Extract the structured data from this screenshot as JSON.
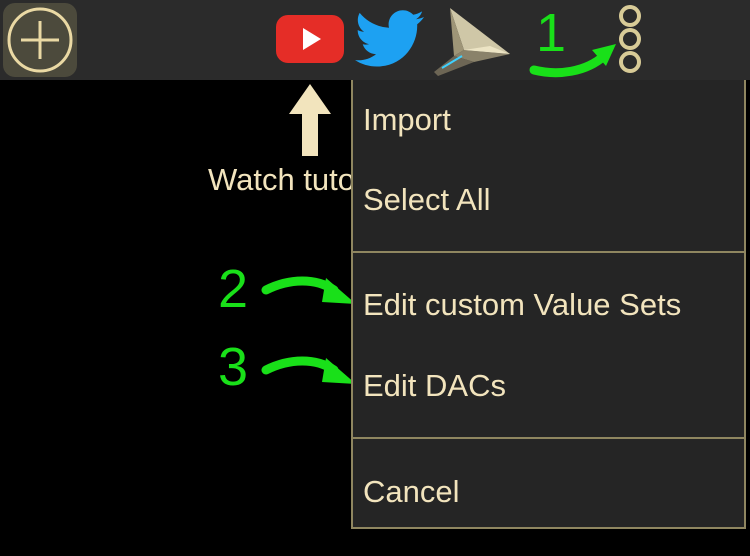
{
  "toolbar": {
    "add_icon": "plus-circle-icon",
    "youtube_icon": "youtube-icon",
    "twitter_icon": "twitter-icon",
    "app_icon": "paper-plane-app-icon",
    "more_icon": "vertical-ellipsis-icon"
  },
  "hint": {
    "tutorial_label": "Watch tuto"
  },
  "annotations": {
    "step1": "1",
    "step2": "2",
    "step3": "3"
  },
  "menu": {
    "items": [
      {
        "label": "Import"
      },
      {
        "label": "Select All"
      },
      {
        "label": "Edit custom Value Sets"
      },
      {
        "label": "Edit DACs"
      },
      {
        "label": "Cancel"
      }
    ]
  },
  "colors": {
    "toolbar_bg": "#2b2b2b",
    "menu_bg": "#252525",
    "menu_border": "#8f8660",
    "menu_text": "#f2e4bd",
    "annotation_green": "#19e019",
    "accent_gold": "#d8cb97"
  }
}
